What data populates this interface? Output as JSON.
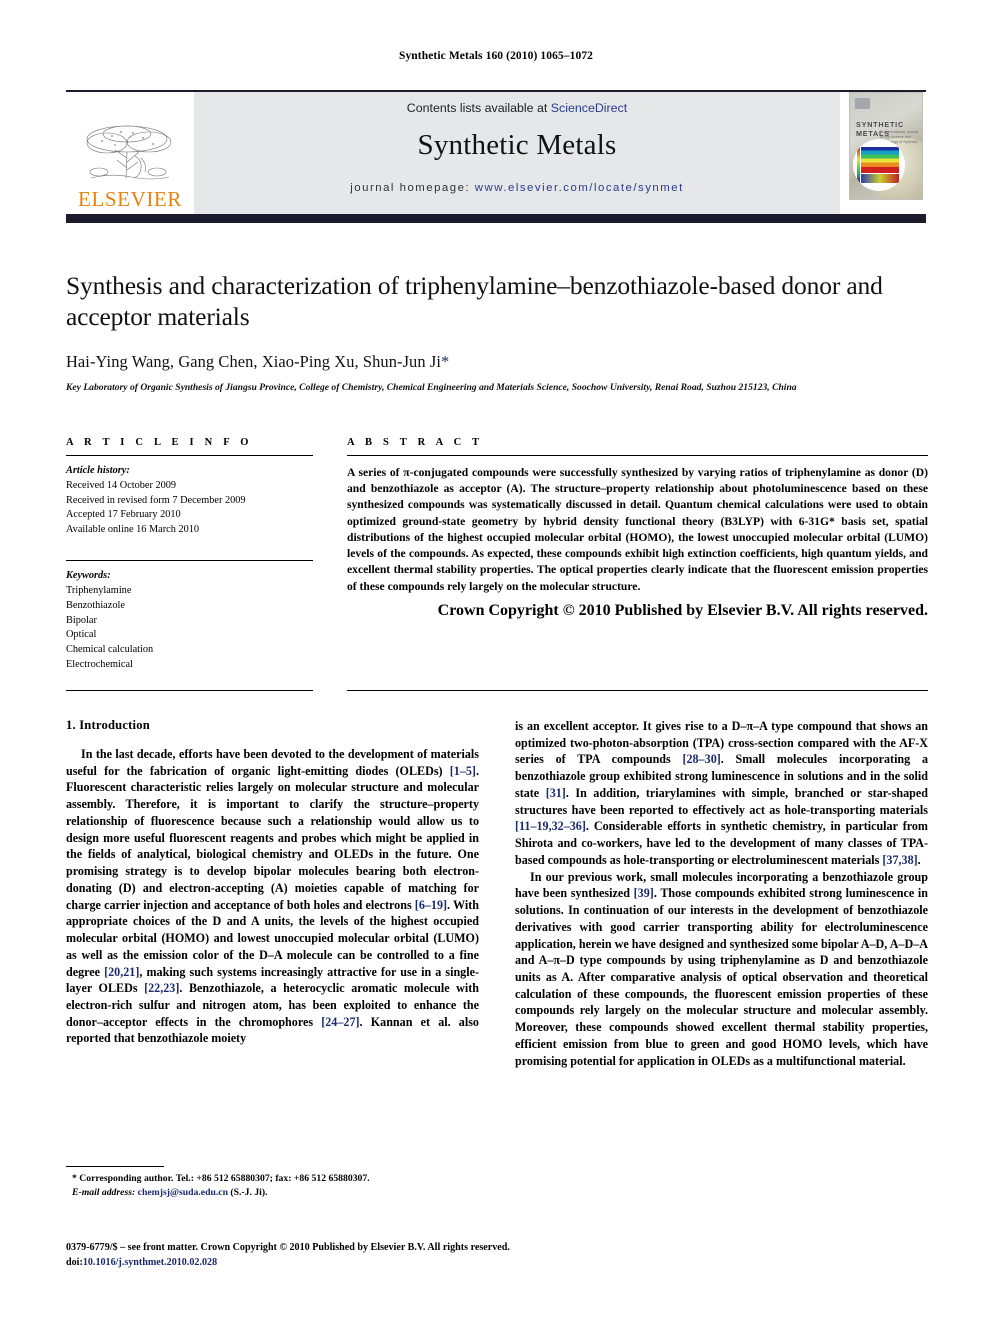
{
  "running_head": "Synthetic Metals 160 (2010) 1065–1072",
  "masthead": {
    "contents_prefix": "Contents lists available at ",
    "sciencedirect": "ScienceDirect",
    "journal_title": "Synthetic Metals",
    "homepage_prefix": "journal homepage: ",
    "homepage_url": "www.elsevier.com/locate/synmet",
    "publisher_wordmark": "ELSEVIER",
    "publisher_color": "#E8820C",
    "band_color": "#e6e7e9",
    "bar_color": "#1b1b2e",
    "cover": {
      "title": "SYNTHETIC METALS",
      "subtitle": "An International Journal on the Science and Technology of Synthetic Metals"
    }
  },
  "article": {
    "title": "Synthesis and characterization of triphenylamine–benzothiazole-based donor and acceptor materials",
    "authors": "Hai-Ying Wang, Gang Chen, Xiao-Ping Xu, Shun-Jun Ji",
    "corresponding_marker": "*",
    "affiliation": "Key Laboratory of Organic Synthesis of Jiangsu Province, College of Chemistry, Chemical Engineering and Materials Science, Soochow University, Renai Road, Suzhou 215123, China"
  },
  "info": {
    "heading": "A R T I C L E    I N F O",
    "history_label": "Article history:",
    "history": [
      "Received 14 October 2009",
      "Received in revised form 7 December 2009",
      "Accepted 17 February 2010",
      "Available online 16 March 2010"
    ],
    "keywords_label": "Keywords:",
    "keywords": [
      "Triphenylamine",
      "Benzothiazole",
      "Bipolar",
      "Optical",
      "Chemical calculation",
      "Electrochemical"
    ]
  },
  "abstract": {
    "heading": "A B S T R A C T",
    "text": "A series of π-conjugated compounds were successfully synthesized by varying ratios of triphenylamine as donor (D) and benzothiazole as acceptor (A). The structure–property relationship about photoluminescence based on these synthesized compounds was systematically discussed in detail. Quantum chemical calculations were used to obtain optimized ground-state geometry by hybrid density functional theory (B3LYP) with 6-31G* basis set, spatial distributions of the highest occupied molecular orbital (HOMO), the lowest unoccupied molecular orbital (LUMO) levels of the compounds. As expected, these compounds exhibit high extinction coefficients, high quantum yields, and excellent thermal stability properties. The optical properties clearly indicate that the fluorescent emission properties of these compounds rely largely on the molecular structure.",
    "copyright": "Crown Copyright © 2010 Published by Elsevier B.V. All rights reserved."
  },
  "body": {
    "section_number_title": "1.  Introduction",
    "left_paragraph_1_a": "In the last decade, efforts have been devoted to the development of materials useful for the fabrication of organic light-emitting diodes (OLEDs) ",
    "ref_1_5": "[1–5]",
    "left_paragraph_1_b": ". Fluorescent characteristic relies largely on molecular structure and molecular assembly. Therefore, it is important to clarify the structure–property relationship of fluorescence because such a relationship would allow us to design more useful fluorescent reagents and probes which might be applied in the fields of analytical, biological chemistry and OLEDs in the future. One promising strategy is to develop bipolar molecules bearing both electron-donating (D) and electron-accepting (A) moieties capable of matching for charge carrier injection and acceptance of both holes and electrons ",
    "ref_6_19": "[6–19]",
    "left_paragraph_1_c": ". With appropriate choices of the D and A units, the levels of the highest occupied molecular orbital (HOMO) and lowest unoccupied molecular orbital (LUMO) as well as the emission color of the D–A molecule can be controlled to a fine degree ",
    "ref_20_21": "[20,21]",
    "left_paragraph_1_d": ", making such systems increasingly attractive for use in a single-layer OLEDs ",
    "ref_22_23": "[22,23]",
    "left_paragraph_1_e": ". Benzothiazole, a heterocyclic aromatic molecule with electron-rich sulfur and nitrogen atom, has been exploited to enhance the donor–acceptor effects in the chromophores ",
    "ref_24_27": "[24–27]",
    "left_paragraph_1_f": ". Kannan et al. also reported that benzothiazole moiety",
    "right_paragraph_1_a": "is an excellent acceptor. It gives rise to a D–π–A type compound that shows an optimized two-photon-absorption (TPA) cross-section compared with the AF-X series of TPA compounds ",
    "ref_28_30": "[28–30]",
    "right_paragraph_1_b": ". Small molecules incorporating a benzothiazole group exhibited strong luminescence in solutions and in the solid state ",
    "ref_31": "[31]",
    "right_paragraph_1_c": ". In addition, triarylamines with simple, branched or star-shaped structures have been reported to effectively act as hole-transporting materials ",
    "ref_11_19_32_36": "[11–19,32–36]",
    "right_paragraph_1_d": ". Considerable efforts in synthetic chemistry, in particular from Shirota and co-workers, have led to the development of many classes of TPA-based compounds as hole-transporting or electroluminescent materials ",
    "ref_37_38": "[37,38]",
    "right_paragraph_1_e": ".",
    "right_paragraph_2_a": "In our previous work, small molecules incorporating a benzothiazole group have been synthesized ",
    "ref_39": "[39]",
    "right_paragraph_2_b": ". Those compounds exhibited strong luminescence in solutions. In continuation of our interests in the development of benzothiazole derivatives with good carrier transporting ability for electroluminescence application, herein we have designed and synthesized some bipolar A–D, A–D–A and A–π–D type compounds by using triphenylamine as D and benzothiazole units as A. After comparative analysis of optical observation and theoretical calculation of these compounds, the fluorescent emission properties of these compounds rely largely on the molecular structure and molecular assembly. Moreover, these compounds showed excellent thermal stability properties, efficient emission from blue to green and good HOMO levels, which have promising potential for application in OLEDs as a multifunctional material."
  },
  "footnote": {
    "marker": "*",
    "corresponding": " Corresponding author. Tel.: +86 512 65880307; fax: +86 512 65880307.",
    "email_label": "E-mail address:",
    "email": "chemjsj@suda.edu.cn",
    "email_suffix": " (S.-J. Ji)."
  },
  "footer": {
    "front_matter": "0379-6779/$ – see front matter. Crown Copyright © 2010 Published by Elsevier B.V. All rights reserved.",
    "doi_label": "doi:",
    "doi": "10.1016/j.synthmet.2010.02.028"
  }
}
